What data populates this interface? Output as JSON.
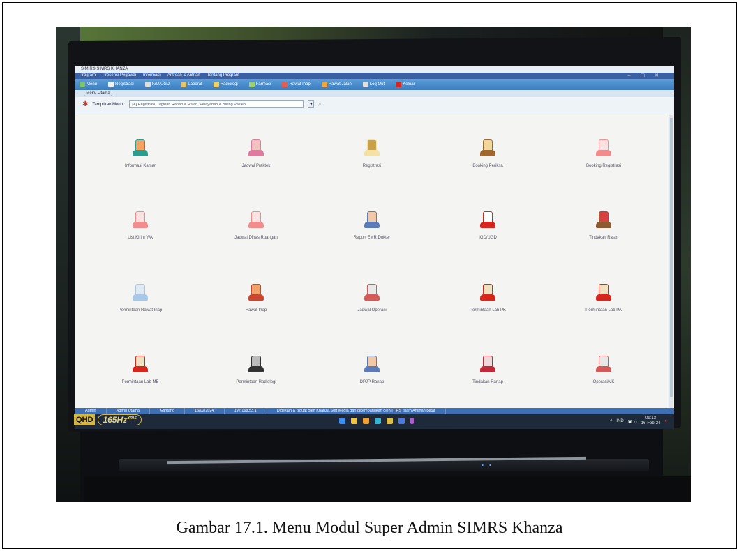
{
  "window": {
    "title": "SIM RS SIMRS KHANZA"
  },
  "menubar": [
    "Program",
    "Presensi Pegawai",
    "Informasi",
    "Antrean & Antrian",
    "Tentang Program"
  ],
  "toolbar": [
    "Menu",
    "Registrasi",
    "IGD/UGD",
    "Laborat",
    "Radiologi",
    "Farmasi",
    "Rawat Inap",
    "Rawat Jalan",
    "Log Out",
    "Keluar"
  ],
  "tab": {
    "label": "[ Menu Utama ]"
  },
  "filter": {
    "label": "Tampilkan Menu :",
    "value": "[A] Registrasi, Tagihan Ranap & Ralan, Pelayanan & Billing Pasien"
  },
  "modules": [
    {
      "label": "Informasi Kamar",
      "icon": "bed-info-icon"
    },
    {
      "label": "Jadwal Praktek",
      "icon": "doctor-schedule-icon"
    },
    {
      "label": "Registrasi",
      "icon": "clipboard-icon"
    },
    {
      "label": "Booking Periksa",
      "icon": "book-icon"
    },
    {
      "label": "Booking Registrasi",
      "icon": "computer-icon"
    },
    {
      "label": "List Kirim WA",
      "icon": "computer-icon"
    },
    {
      "label": "Jadwal Dinas Ruangan",
      "icon": "computer-icon"
    },
    {
      "label": "Report EMR Dokter",
      "icon": "doctor-icon"
    },
    {
      "label": "IGD/UGD",
      "icon": "ambulance-icon"
    },
    {
      "label": "Tindakan Ralan",
      "icon": "infusion-icon"
    },
    {
      "label": "Permintaan Rawat Inap",
      "icon": "syringe-icon"
    },
    {
      "label": "Rawat Inap",
      "icon": "house-icon"
    },
    {
      "label": "Jadwal Operasi",
      "icon": "surgeon-icon"
    },
    {
      "label": "Permintaan Lab PK",
      "icon": "flask-icon"
    },
    {
      "label": "Permintaan Lab PA",
      "icon": "flask-icon"
    },
    {
      "label": "Permintaan Lab MB",
      "icon": "flask-icon"
    },
    {
      "label": "Permintaan Radiologi",
      "icon": "xray-icon"
    },
    {
      "label": "DPJP Ranap",
      "icon": "doctor-icon"
    },
    {
      "label": "Tindakan Ranap",
      "icon": "bed-icon"
    },
    {
      "label": "Operasi/VK",
      "icon": "surgeon-icon"
    }
  ],
  "statusbar": [
    "Admin",
    "Admin Utama",
    "Gantang",
    "16/02/2024",
    "192.168.53.1",
    "Didesain & dibuat oleh Khanza.Soft Media dan dikembangkan oleh IT RS Islam Aminah Blitar"
  ],
  "tray": {
    "lang": "IND",
    "time": "09:13",
    "date": "16-Feb-24"
  },
  "monitor": {
    "qhd": "QHD",
    "hz": "165Hz",
    "ms": "3ms"
  },
  "caption": "Gambar 17.1. Menu Modul Super Admin SIMRS Khanza"
}
